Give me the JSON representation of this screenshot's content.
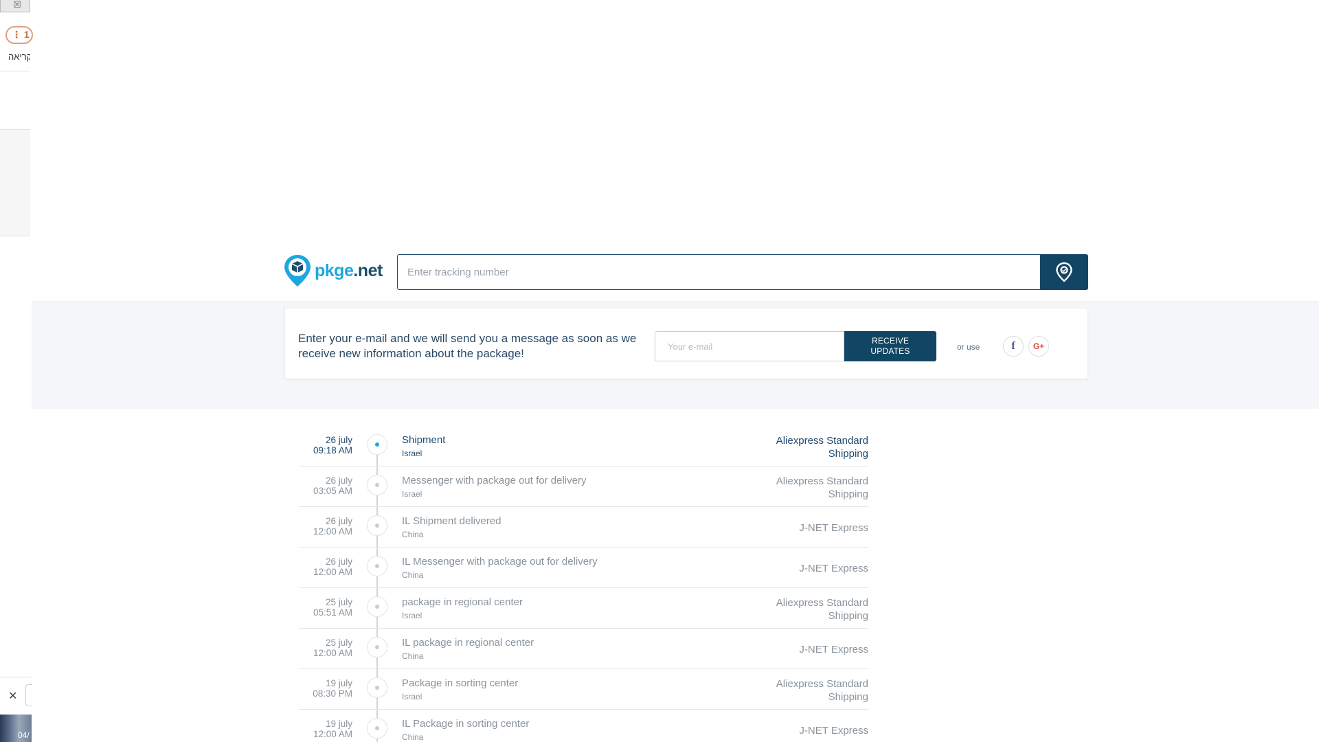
{
  "left_panel": {
    "close_symbol": "☒",
    "pill_text": "⋮ 1",
    "hebrew_text": "קריאה",
    "close_x": "✕",
    "thumb_text": "04/"
  },
  "header": {
    "logo_brand": "pkge",
    "logo_tld": ".net",
    "search_placeholder": "Enter tracking number",
    "search_icon": "location-pin-icon"
  },
  "notify": {
    "message": "Enter your e-mail and we will send you a message as soon as we receive new information about the package!",
    "email_placeholder": "Your e-mail",
    "receive_label_line1": "RECEIVE",
    "receive_label_line2": "UPDATES",
    "or_use": "or use",
    "facebook_label": "f",
    "google_label": "G+"
  },
  "colors": {
    "brand_blue": "#1da7e0",
    "navy": "#114563",
    "text": "#2a4a66",
    "muted": "#8a939c"
  },
  "timeline": [
    {
      "day": "26 july",
      "time": "09:18 AM",
      "event": "Shipment",
      "location": "Israel",
      "carrier_line1": "Aliexpress Standard",
      "carrier_line2": "Shipping"
    },
    {
      "day": "26 july",
      "time": "03:05 AM",
      "event": "Messenger with package out for delivery",
      "location": "Israel",
      "carrier_line1": "Aliexpress Standard",
      "carrier_line2": "Shipping"
    },
    {
      "day": "26 july",
      "time": "12:00 AM",
      "event": "IL Shipment delivered",
      "location": "China",
      "carrier_line1": "J-NET Express",
      "carrier_line2": ""
    },
    {
      "day": "26 july",
      "time": "12:00 AM",
      "event": "IL Messenger with package out for delivery",
      "location": "China",
      "carrier_line1": "J-NET Express",
      "carrier_line2": ""
    },
    {
      "day": "25 july",
      "time": "05:51 AM",
      "event": "package in regional center",
      "location": "Israel",
      "carrier_line1": "Aliexpress Standard",
      "carrier_line2": "Shipping"
    },
    {
      "day": "25 july",
      "time": "12:00 AM",
      "event": "IL package in regional center",
      "location": "China",
      "carrier_line1": "J-NET Express",
      "carrier_line2": ""
    },
    {
      "day": "19 july",
      "time": "08:30 PM",
      "event": "Package in sorting center",
      "location": "Israel",
      "carrier_line1": "Aliexpress Standard",
      "carrier_line2": "Shipping"
    },
    {
      "day": "19 july",
      "time": "12:00 AM",
      "event": "IL Package in sorting center",
      "location": "China",
      "carrier_line1": "J-NET Express",
      "carrier_line2": ""
    }
  ]
}
